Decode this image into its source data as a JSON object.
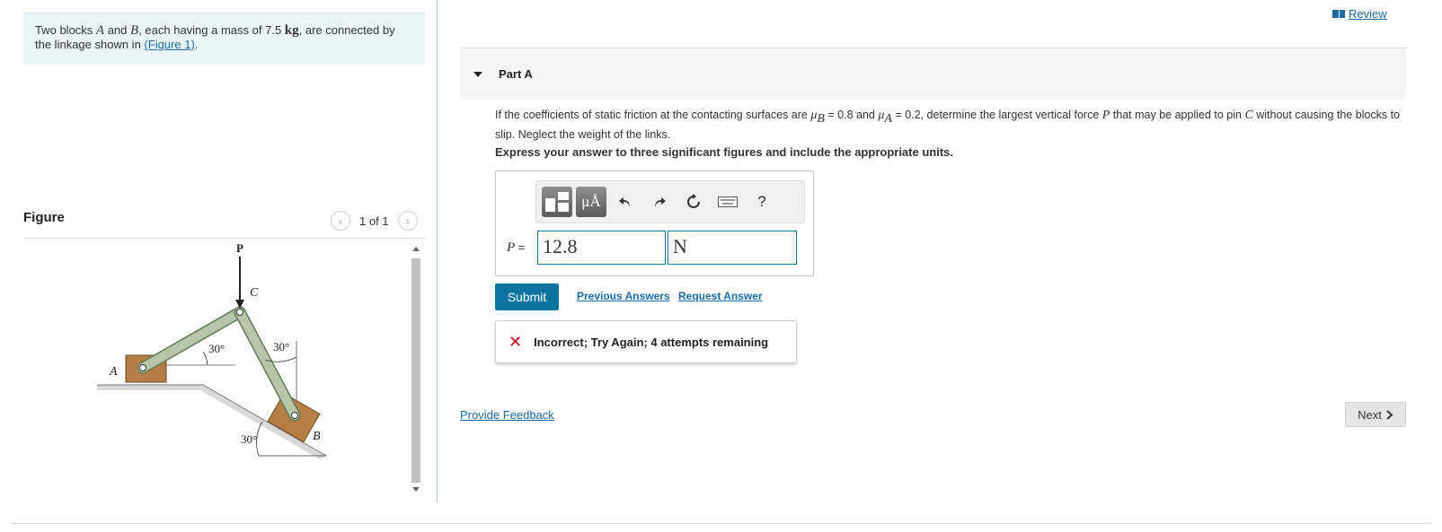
{
  "intro": {
    "text_1": "Two blocks ",
    "block_a": "A",
    "text_2": " and ",
    "block_b": "B",
    "text_3": ", each having a mass of 7.5 ",
    "unit": "kg",
    "text_4": ", are connected by the linkage shown in ",
    "figure_link": "(Figure 1)",
    "text_5": "."
  },
  "figure": {
    "title": "Figure",
    "counter": "1 of 1",
    "labels": {
      "p": "P",
      "c": "C",
      "a": "A",
      "b": "B",
      "angle_left": "30°",
      "angle_right": "30°",
      "angle_incline": "30°"
    }
  },
  "header": {
    "review_label": "Review"
  },
  "part": {
    "label": "Part A"
  },
  "question": {
    "t1": "If the coefficients of static friction at the contacting surfaces are ",
    "mu": "μ",
    "sub_b": "B",
    "t2": " = 0.8 and ",
    "sub_a": "A",
    "t3": " = 0.2, determine the largest vertical force ",
    "p": "P",
    "t4": " that may be applied to pin ",
    "c": "C",
    "t5": " without causing the blocks to slip. Neglect the weight of the links."
  },
  "instructions": "Express your answer to three significant figures and include the appropriate units.",
  "toolbar": {
    "units_button": "μÅ",
    "help_button": "?"
  },
  "answer": {
    "variable": "P",
    "equals": " =",
    "value": "12.8",
    "unit": "N"
  },
  "actions": {
    "submit": "Submit",
    "previous_answers": "Previous Answers",
    "request_answer": "Request Answer"
  },
  "feedback": {
    "message": "Incorrect; Try Again; 4 attempts remaining"
  },
  "footer": {
    "provide_feedback": "Provide Feedback",
    "next": "Next"
  },
  "colors": {
    "accent": "#0b74a0",
    "link": "#1a6aa5",
    "error": "#d0021b",
    "intro_bg": "#e9f5f7"
  }
}
